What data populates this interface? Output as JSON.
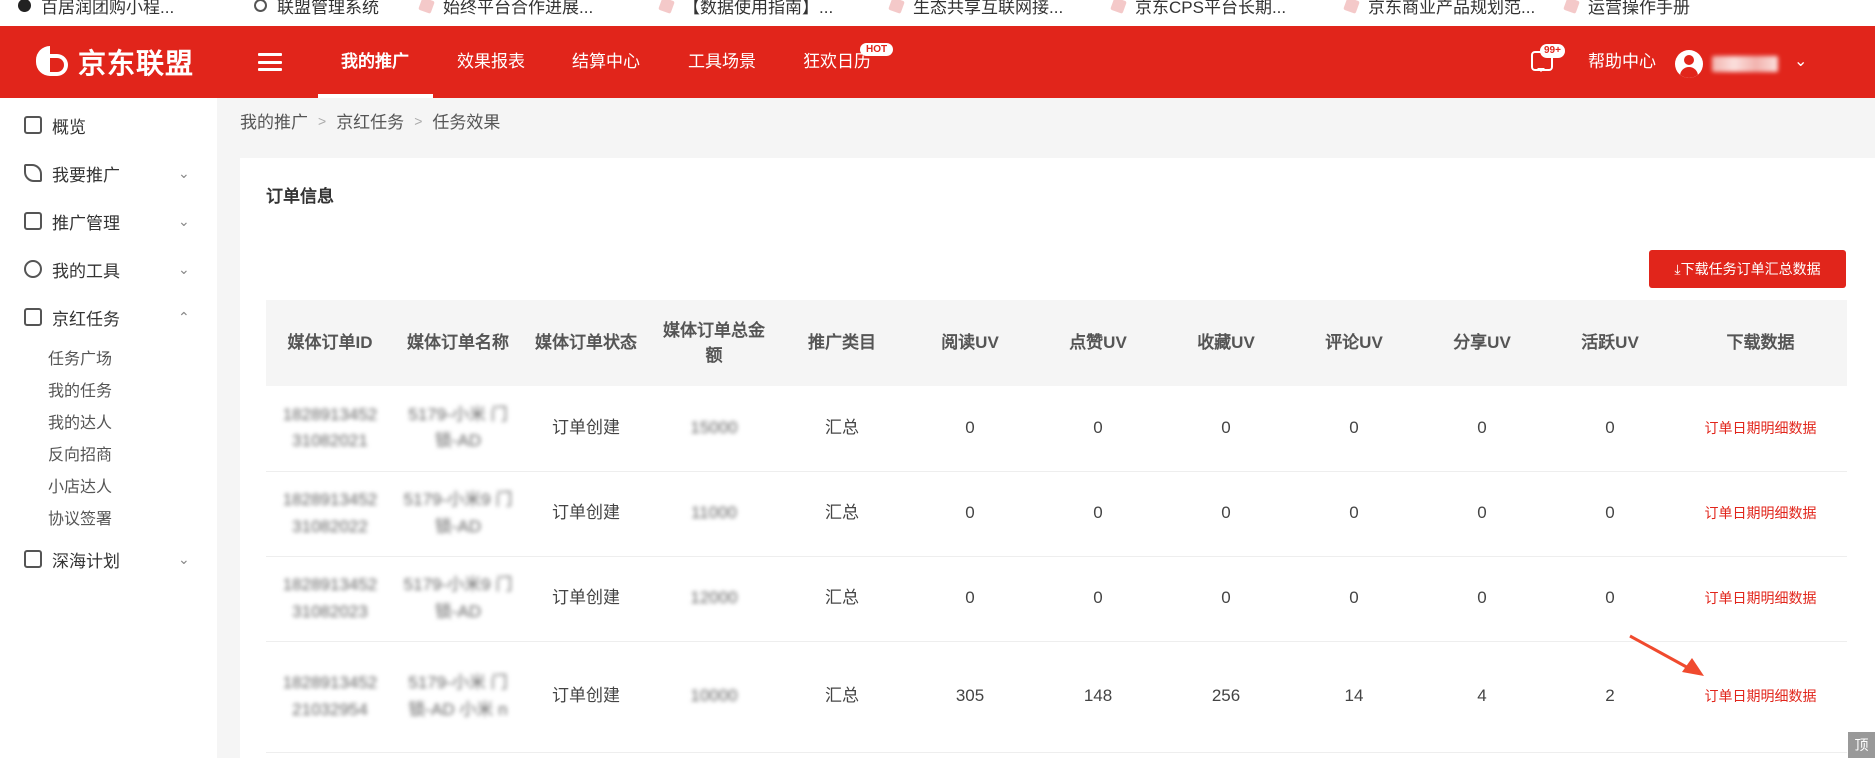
{
  "bookmarks": [
    "百居润团购小程...",
    "联盟管理系统",
    "始终平台合作进展...",
    "【数据使用指南】...",
    "生态共享互联网接...",
    "京东CPS平台长期...",
    "京东商业产品规划范...",
    "运营操作手册"
  ],
  "brand": {
    "name": "京东联盟",
    "accent": "#e1251b"
  },
  "nav": {
    "items": [
      "我的推广",
      "效果报表",
      "结算中心",
      "工具场景",
      "狂欢日历"
    ],
    "active": "我的推广",
    "hot_badge": "HOT",
    "message_badge": "99+",
    "help": "帮助中心"
  },
  "sidebar": {
    "items": [
      {
        "label": "概览",
        "icon": "monitor-icon"
      },
      {
        "label": "我要推广",
        "icon": "send-icon"
      },
      {
        "label": "推广管理",
        "icon": "manage-icon"
      },
      {
        "label": "我的工具",
        "icon": "tools-icon"
      },
      {
        "label": "京红任务",
        "icon": "task-icon"
      },
      {
        "label": "深海计划",
        "icon": "plan-icon"
      }
    ],
    "sub_items": [
      "任务广场",
      "我的任务",
      "我的达人",
      "反向招商",
      "小店达人",
      "协议签署"
    ]
  },
  "breadcrumb": [
    "我的推广",
    "京红任务",
    "任务效果"
  ],
  "card": {
    "title": "订单信息",
    "download_button": "下载任务订单汇总数据"
  },
  "table": {
    "columns": [
      "媒体订单ID",
      "媒体订单名称",
      "媒体订单状态",
      "媒体订单总金额",
      "推广类目",
      "阅读UV",
      "点赞UV",
      "收藏UV",
      "评论UV",
      "分享UV",
      "活跃UV",
      "下载数据"
    ],
    "rows": [
      {
        "id": "1828913452 31082021",
        "name": "5179-小米 门锁-AD",
        "status": "订单创建",
        "amount": "15000",
        "category": "汇总",
        "read": "0",
        "like": "0",
        "fav": "0",
        "comment": "0",
        "share": "0",
        "active": "0",
        "action": "订单日期明细数据"
      },
      {
        "id": "1828913452 31082022",
        "name": "5179-小米9 门锁-AD",
        "status": "订单创建",
        "amount": "11000",
        "category": "汇总",
        "read": "0",
        "like": "0",
        "fav": "0",
        "comment": "0",
        "share": "0",
        "active": "0",
        "action": "订单日期明细数据"
      },
      {
        "id": "1828913452 31082023",
        "name": "5179-小米9 门锁-AD",
        "status": "订单创建",
        "amount": "12000",
        "category": "汇总",
        "read": "0",
        "like": "0",
        "fav": "0",
        "comment": "0",
        "share": "0",
        "active": "0",
        "action": "订单日期明细数据"
      },
      {
        "id": "1828913452 21032954",
        "name": "5179-小米 门锁-AD 小米 n",
        "status": "订单创建",
        "amount": "10000",
        "category": "汇总",
        "read": "305",
        "like": "148",
        "fav": "256",
        "comment": "14",
        "share": "4",
        "active": "2",
        "action": "订单日期明细数据"
      }
    ]
  },
  "scroll_top_label": "顶"
}
